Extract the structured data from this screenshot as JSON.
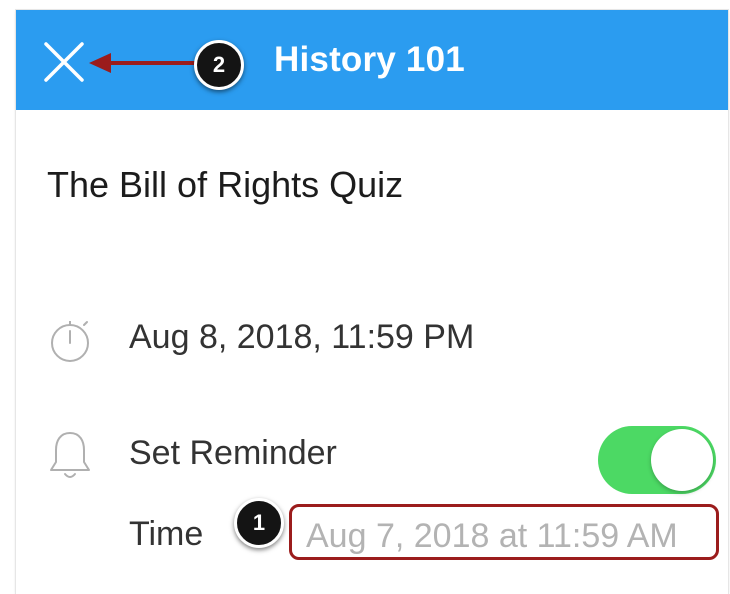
{
  "nav": {
    "title": "History 101",
    "close_icon": "close-icon"
  },
  "assignment": {
    "title": "The Bill of Rights Quiz",
    "due_date": "Aug 8, 2018, 11:59 PM",
    "due_icon": "stopwatch-icon"
  },
  "reminder": {
    "label": "Set Reminder",
    "icon": "bell-icon",
    "enabled": true,
    "time_label": "Time",
    "time_value": "Aug 7, 2018 at 11:59 AM"
  },
  "callouts": [
    "1",
    "2"
  ],
  "colors": {
    "nav_bar": "#2B9CF0",
    "toggle_on": "#4CD964",
    "highlight": "#9B1C1C"
  }
}
